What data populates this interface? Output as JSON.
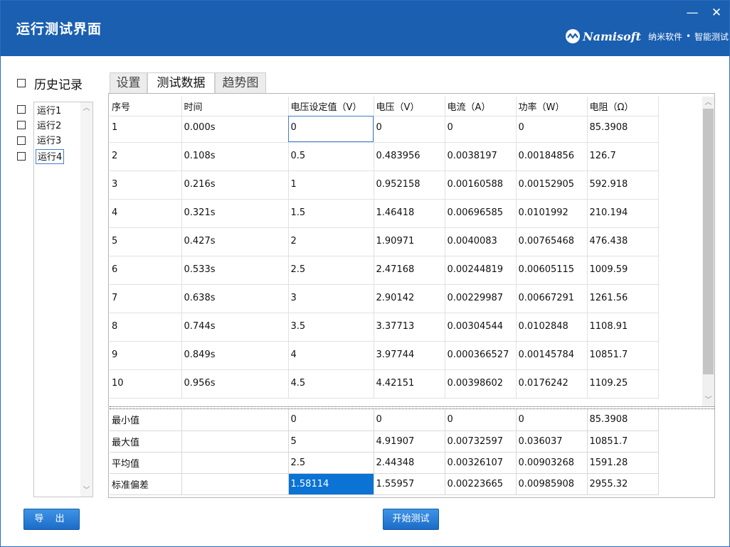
{
  "window": {
    "title": "运行测试界面",
    "minimize_glyph": "—",
    "close_glyph": "✕",
    "brand_name": "Namisoft",
    "brand_sub1": "纳米软件",
    "brand_dot": "•",
    "brand_sub2": "智能测试"
  },
  "sidebar": {
    "history_label": "历史记录",
    "runs": [
      {
        "label": "运行1",
        "selected": false
      },
      {
        "label": "运行2",
        "selected": false
      },
      {
        "label": "运行3",
        "selected": false
      },
      {
        "label": "运行4",
        "selected": true
      }
    ]
  },
  "tabs": [
    {
      "label": "设置",
      "active": false
    },
    {
      "label": "测试数据",
      "active": true
    },
    {
      "label": "趋势图",
      "active": false
    }
  ],
  "table": {
    "headers": [
      "序号",
      "时间",
      "电压设定值（V）",
      "电压（V）",
      "电流（A）",
      "功率（W）",
      "电阻（Ω）"
    ],
    "rows": [
      [
        "1",
        "0.000s",
        "0",
        "0",
        "0",
        "0",
        "85.3908"
      ],
      [
        "2",
        "0.108s",
        "0.5",
        "0.483956",
        "0.0038197",
        "0.00184856",
        "126.7"
      ],
      [
        "3",
        "0.216s",
        "1",
        "0.952158",
        "0.00160588",
        "0.00152905",
        "592.918"
      ],
      [
        "4",
        "0.321s",
        "1.5",
        "1.46418",
        "0.00696585",
        "0.0101992",
        "210.194"
      ],
      [
        "5",
        "0.427s",
        "2",
        "1.90971",
        "0.0040083",
        "0.00765468",
        "476.438"
      ],
      [
        "6",
        "0.533s",
        "2.5",
        "2.47168",
        "0.00244819",
        "0.00605115",
        "1009.59"
      ],
      [
        "7",
        "0.638s",
        "3",
        "2.90142",
        "0.00229987",
        "0.00667291",
        "1261.56"
      ],
      [
        "8",
        "0.744s",
        "3.5",
        "3.37713",
        "0.00304544",
        "0.0102848",
        "1108.91"
      ],
      [
        "9",
        "0.849s",
        "4",
        "3.97744",
        "0.000366527",
        "0.00145784",
        "10851.7"
      ],
      [
        "10",
        "0.956s",
        "4.5",
        "4.42151",
        "0.00398602",
        "0.0176242",
        "1109.25"
      ]
    ]
  },
  "stats": {
    "rows": [
      [
        "最小值",
        "",
        "0",
        "0",
        "0",
        "0",
        "85.3908"
      ],
      [
        "最大值",
        "",
        "5",
        "4.91907",
        "0.00732597",
        "0.036037",
        "10851.7"
      ],
      [
        "平均值",
        "",
        "2.5",
        "2.44348",
        "0.00326107",
        "0.00903268",
        "1591.28"
      ],
      [
        "标准偏差",
        "",
        "1.58114",
        "1.55957",
        "0.00223665",
        "0.00985908",
        "2955.32"
      ]
    ]
  },
  "buttons": {
    "export_label": "导 出",
    "start_label": "开始测试"
  },
  "colors": {
    "titlebar": "#1a5fb0",
    "button": "#1c6cc7",
    "selection": "#0b73d3"
  }
}
